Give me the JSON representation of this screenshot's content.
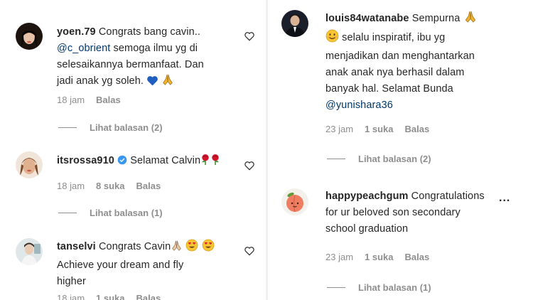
{
  "comments_left": [
    {
      "username": "yoen.79",
      "text_lines": [
        "Congrats bang cavin..",
        "semoga ilmu yg di",
        "selesaikannya bermanfaat. Dan",
        "jadi anak yg soleh."
      ],
      "mention": "@c_obrient",
      "time": "18 jam",
      "reply": "Balas",
      "view_replies": "Lihat balasan (2)"
    },
    {
      "username": "itsrossa910",
      "text": "Selamat Calvin",
      "time": "18 jam",
      "likes": "8 suka",
      "reply": "Balas",
      "view_replies": "Lihat balasan (1)"
    },
    {
      "username": "tanselvi",
      "text_lines": [
        "Congrats Cavin",
        "Achieve your dream and fly",
        "higher"
      ],
      "time": "18 jam",
      "likes": "1 suka",
      "reply": "Balas"
    }
  ],
  "comments_right": [
    {
      "username": "louis84watanabe",
      "text_lines": [
        "Sempurna",
        "selalu inspiratif, ibu yg",
        "menjadikan dan menghantarkan",
        "anak anak nya berhasil dalam",
        "banyak hal. Selamat Bunda"
      ],
      "mention": "@yunishara36",
      "time": "23 jam",
      "likes": "1 suka",
      "reply": "Balas",
      "view_replies": "Lihat balasan (2)"
    },
    {
      "username": "happypeachgum",
      "text_lines": [
        "Congratulations",
        "for ur beloved son secondary",
        "school graduation"
      ],
      "time": "23 jam",
      "likes": "1 suka",
      "reply": "Balas",
      "view_replies": "Lihat balasan (1)"
    }
  ],
  "more_options": "...",
  "colors": {
    "text": "#262626",
    "secondary": "#8e8e8e",
    "mention": "#00376b",
    "verified": "#3897f0"
  }
}
